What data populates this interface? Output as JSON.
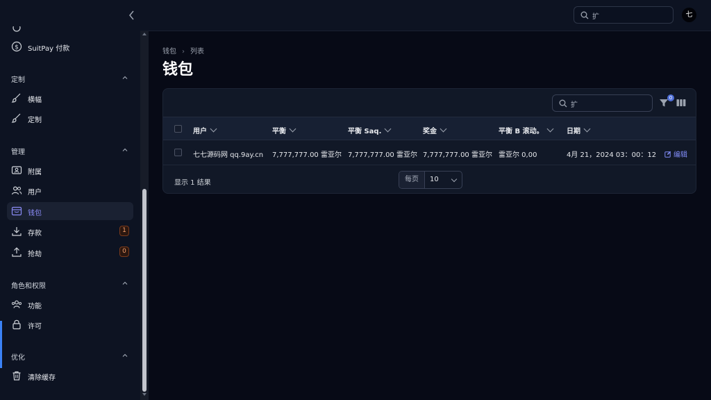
{
  "topbar": {
    "search_value": "扩"
  },
  "user": {
    "avatar_initial": "七"
  },
  "sidebar": {
    "groups": [
      {
        "title": "定制"
      },
      {
        "title": "管理"
      },
      {
        "title": "角色和权限"
      },
      {
        "title": "优化"
      }
    ],
    "items": [
      {
        "label": "SuitPay 付款",
        "icon": "dollar-circle-icon"
      },
      {
        "label": "横幅",
        "icon": "brush-icon"
      },
      {
        "label": "定制",
        "icon": "brush-icon"
      },
      {
        "label": "附属",
        "icon": "id-card-icon"
      },
      {
        "label": "用户",
        "icon": "users-icon"
      },
      {
        "label": "钱包",
        "icon": "wallet-icon",
        "active": true
      },
      {
        "label": "存款",
        "icon": "download-icon",
        "badge": "1"
      },
      {
        "label": "抢劫",
        "icon": "upload-icon",
        "badge": "0"
      },
      {
        "label": "功能",
        "icon": "user-group-icon"
      },
      {
        "label": "许可",
        "icon": "lock-icon"
      },
      {
        "label": "清除缓存",
        "icon": "trash-icon"
      }
    ]
  },
  "breadcrumb": {
    "root": "钱包",
    "current": "列表"
  },
  "page": {
    "title": "钱包"
  },
  "table": {
    "search_value": "扩",
    "filter_count": "0",
    "columns": [
      "用户",
      "平衡",
      "平衡 Saq.",
      "奖金",
      "平衡 B 滚动。",
      "日期"
    ],
    "rows": [
      {
        "user": "七七源码网 qq.9ay.cn",
        "balance": "7,777,777.00 雷亚尔",
        "balance_saq": "7,777,777.00 雷亚尔",
        "bonus": "7,777,777.00 雷亚尔",
        "balance_b": "雷亚尔 0,00",
        "date": "4月 21，2024 03：00：12",
        "action": "编辑"
      }
    ],
    "results_text": "显示 1 结果",
    "per_page_label": "每页",
    "per_page_value": "10"
  },
  "colors": {
    "accent": "#818cf8",
    "sidebar_bg": "#0d1322",
    "page_bg": "#070a16",
    "badge": "#f59e6b"
  }
}
